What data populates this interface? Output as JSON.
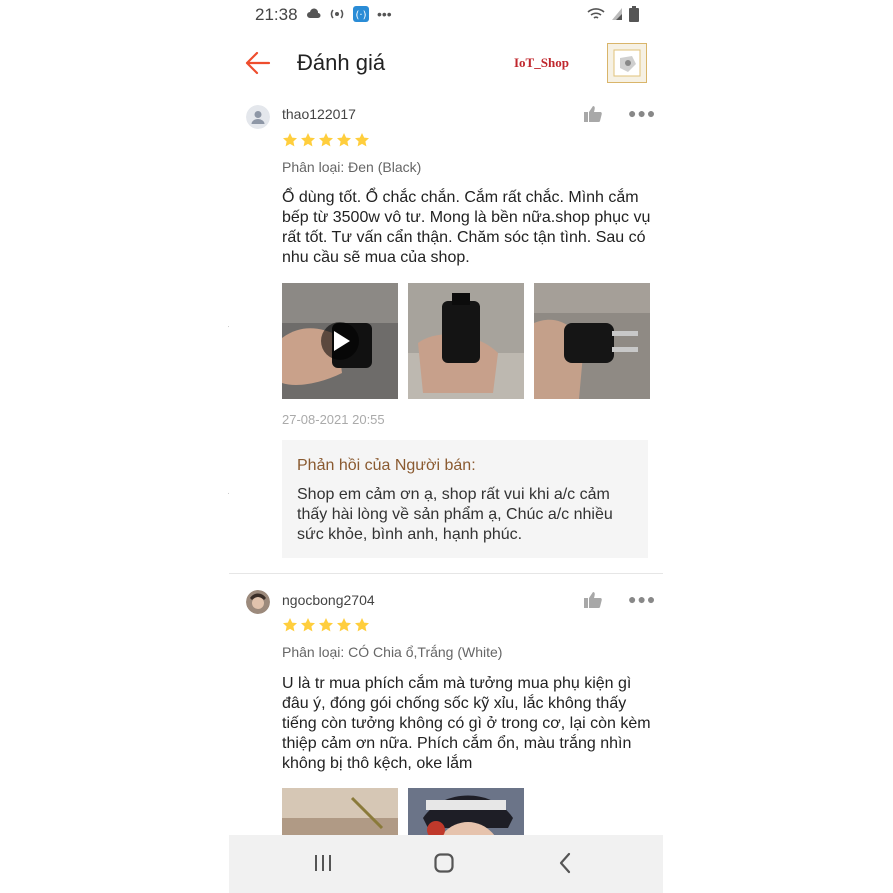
{
  "status_bar": {
    "time": "21:38"
  },
  "header": {
    "title": "Đánh giá",
    "shop_name": "IoT_Shop"
  },
  "reviews": [
    {
      "username": "thao122017",
      "rating": 5,
      "variant": "Phân loại: Đen (Black)",
      "text": "Ổ dùng tốt. Ổ chắc chắn. Cắm rất chắc. Mình cắm bếp từ 3500w vô tư. Mong là bền nữa.shop phục vụ rất tốt. Tư vấn cẩn thận. Chăm sóc tận tình. Sau có nhu cầu sẽ mua của shop.",
      "date": "27-08-2021 20:55",
      "seller_reply": {
        "title": "Phản hồi của Người bán:",
        "text": "Shop em cảm ơn ạ, shop rất vui khi a/c cảm thấy hài lòng về sản phẩm ạ, Chúc a/c nhiều sức khỏe, bình anh, hạnh phúc."
      }
    },
    {
      "username": "ngocbong2704",
      "rating": 5,
      "variant": "Phân loại: CÓ Chia ổ,Trắng (White)",
      "text": "U là tr mua phích cắm mà tưởng mua phụ kiện gì đâu ý, đóng gói chống sốc kỹ xỉu, lắc không thấy tiếng còn tưởng không có gì ở trong cơ, lại còn kèm thiệp cảm ơn nữa. Phích cắm ổn, màu trắng nhìn không bị thô kệch, oke lắm"
    }
  ],
  "colors": {
    "accent": "#ee4d2d",
    "star": "#ffce3d",
    "reply_title": "#8a5a30",
    "shop_name": "#c0272d"
  }
}
